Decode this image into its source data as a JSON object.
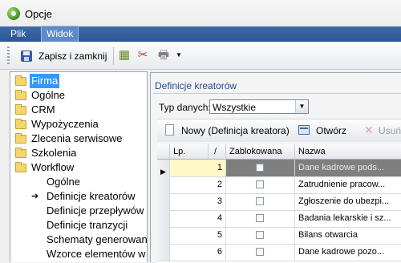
{
  "window": {
    "title": "Opcje"
  },
  "menu": {
    "items": [
      "Plik",
      "Widok"
    ]
  },
  "toolbar": {
    "save_label": "Zapisz i zamknij"
  },
  "tree": {
    "items": [
      {
        "label": "Firma",
        "selected": true
      },
      {
        "label": "Ogólne"
      },
      {
        "label": "CRM"
      },
      {
        "label": "Wypożyczenia"
      },
      {
        "label": "Zlecenia serwisowe"
      },
      {
        "label": "Szkolenia"
      },
      {
        "label": "Workflow"
      }
    ],
    "children": [
      {
        "label": "Ogólne"
      },
      {
        "label": "Definicje kreatorów",
        "current": true
      },
      {
        "label": "Definicje przepływów"
      },
      {
        "label": "Definicje tranzycji"
      },
      {
        "label": "Schematy generowania"
      },
      {
        "label": "Wzorce elementów w"
      }
    ]
  },
  "panel": {
    "title": "Definicje kreatorów",
    "filter_label": "Typ danych:",
    "filter_value": "Wszystkie",
    "new_label": "Nowy (Definicja kreatora)",
    "open_label": "Otwórz",
    "delete_label": "Usuń"
  },
  "grid": {
    "columns": [
      "Lp.",
      "/",
      "Zablokowana",
      "Nazwa"
    ],
    "rows": [
      {
        "lp": "1",
        "locked": false,
        "name": "Dane kadrowe pods..."
      },
      {
        "lp": "2",
        "locked": false,
        "name": "Zatrudnienie pracow..."
      },
      {
        "lp": "3",
        "locked": false,
        "name": "Zgłoszenie do ubezpi..."
      },
      {
        "lp": "4",
        "locked": false,
        "name": "Badania lekarskie i sz..."
      },
      {
        "lp": "5",
        "locked": false,
        "name": "Bilans otwarcia"
      },
      {
        "lp": "6",
        "locked": false,
        "name": "Dane kadrowe pozo..."
      }
    ]
  }
}
